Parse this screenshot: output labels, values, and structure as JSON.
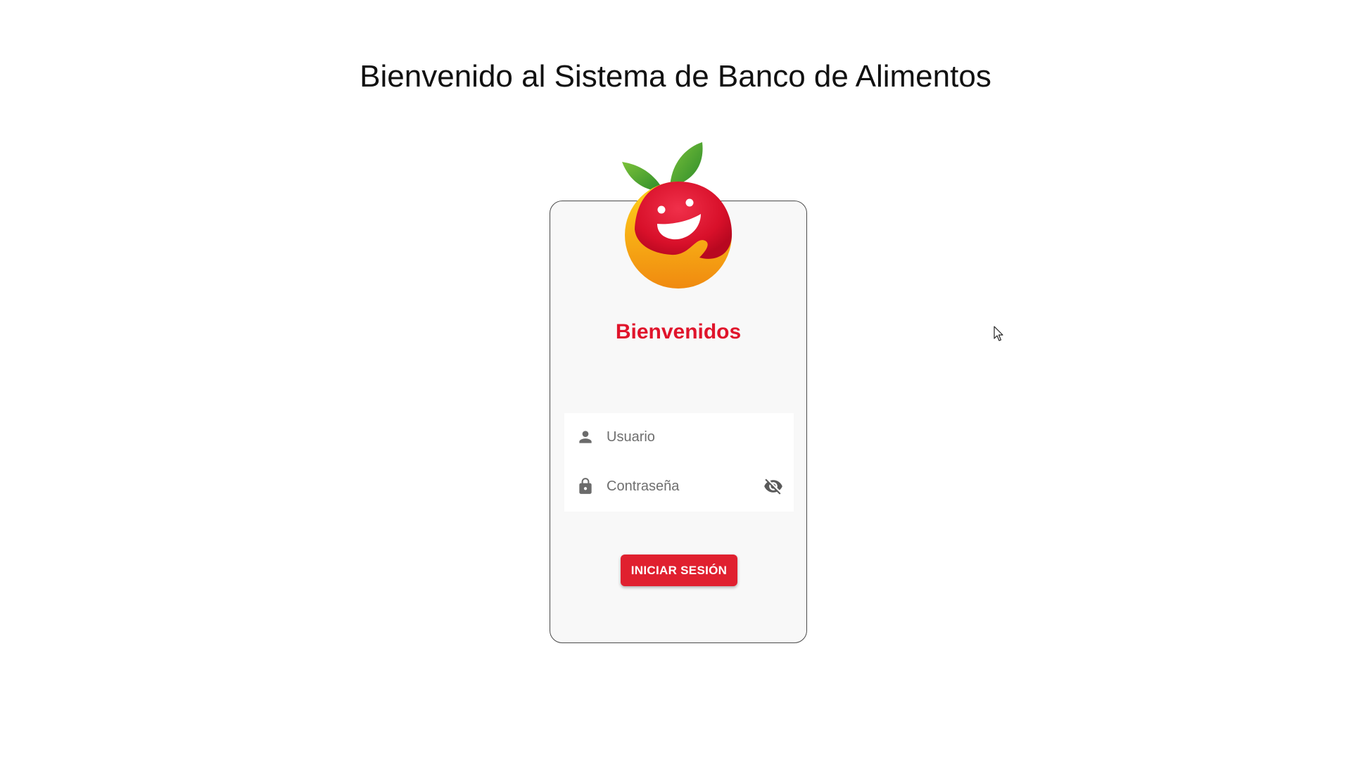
{
  "header": {
    "title": "Bienvenido al Sistema de Banco de Alimentos"
  },
  "login_card": {
    "logo_icon": "smiling-apple-logo",
    "welcome_text": "Bienvenidos",
    "username_field": {
      "placeholder": "Usuario",
      "value": "",
      "icon": "person-icon"
    },
    "password_field": {
      "placeholder": "Contraseña",
      "value": "",
      "icon": "lock-icon",
      "toggle_icon": "visibility-off-icon"
    },
    "submit_label": "INICIAR SESIÓN"
  },
  "colors": {
    "accent": "#e0142b",
    "button": "#e0202f",
    "card_background": "#f8f8f8",
    "card_border": "#4a4a4a"
  }
}
